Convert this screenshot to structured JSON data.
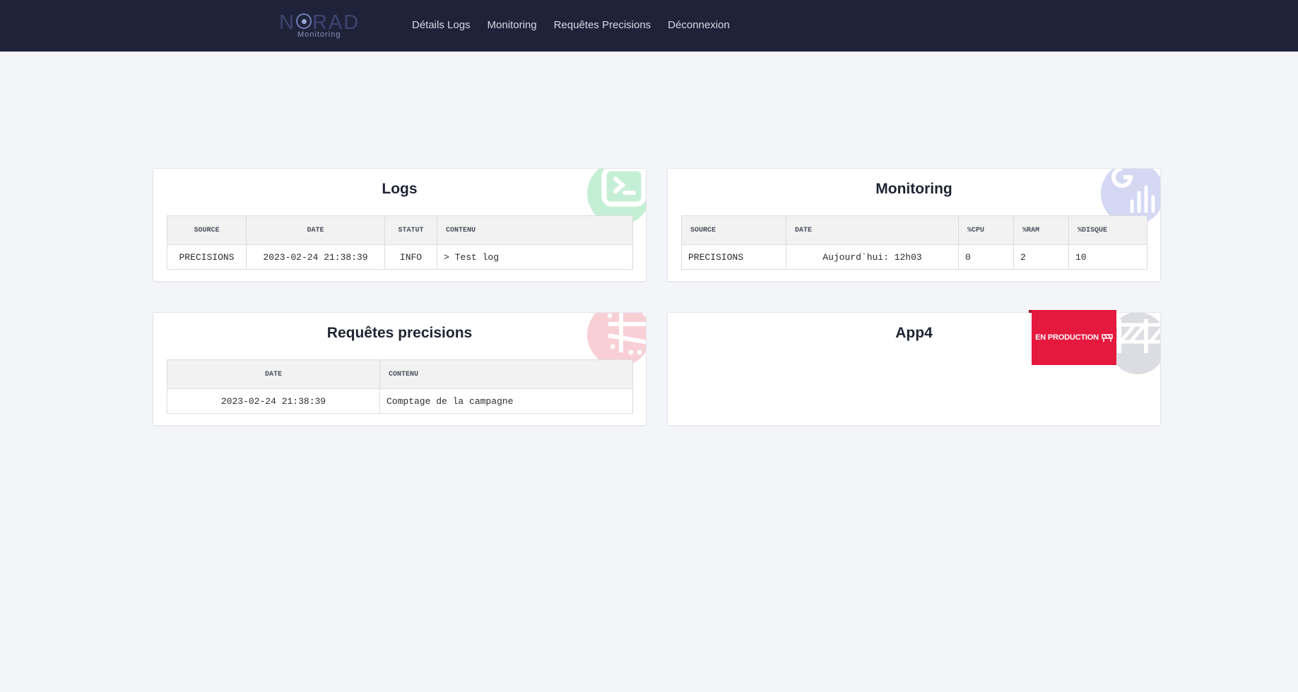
{
  "navbar": {
    "logo_text_1": "N",
    "logo_text_2": "RAD",
    "logo_sub": "Monitoring",
    "links": [
      "Détails Logs",
      "Monitoring",
      "Requêtes Precisions",
      "Déconnexion"
    ]
  },
  "logs_card": {
    "title": "Logs",
    "columns": [
      "SOURCE",
      "DATE",
      "STATUT",
      "CONTENU"
    ],
    "rows": [
      [
        "PRECISIONS",
        "2023-02-24 21:38:39",
        "INFO",
        "> Test log"
      ]
    ]
  },
  "monitoring_card": {
    "title": "Monitoring",
    "columns": [
      "SOURCE",
      "DATE",
      "%CPU",
      "%RAM",
      "%DISQUE"
    ],
    "rows": [
      [
        "PRECISIONS",
        "Aujourd`hui: 12h03",
        "0",
        "2",
        "10"
      ]
    ]
  },
  "requetes_card": {
    "title": "Requêtes precisions",
    "columns": [
      "DATE",
      "CONTENU"
    ],
    "rows": [
      [
        "2023-02-24 21:38:39",
        "Comptage de la campagne"
      ]
    ]
  },
  "app4_card": {
    "title": "App4",
    "badge": "EN PRODUCTION"
  },
  "colors": {
    "navbar": "#1f233a",
    "badge": "#e5183d",
    "logs_accent": "#c5efd4",
    "monitoring_accent": "#d4d8f3",
    "requetes_accent": "#f9cfd6",
    "app4_accent": "#dcdde2"
  },
  "icons": {
    "logs": "terminal-icon",
    "monitoring": "chart-icon",
    "requetes": "dice-icon",
    "app4": "construction-icon",
    "badge": "barrier-icon"
  }
}
